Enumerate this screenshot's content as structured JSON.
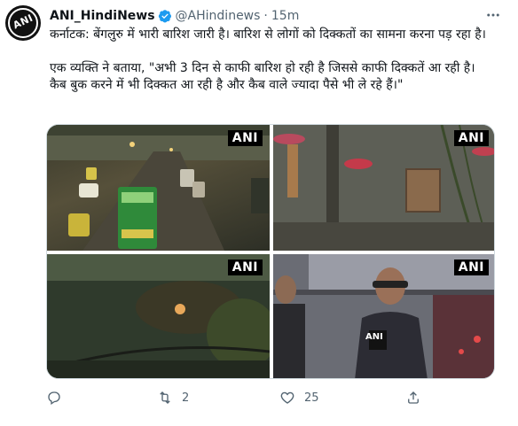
{
  "tweet": {
    "display_name": "ANI_HindiNews",
    "handle": "@AHindinews",
    "separator": "·",
    "time": "15m",
    "avatar_text": "ANI",
    "paragraph1": "कर्नाटक: बेंगलुरु में भारी बारिश जारी है। बारिश से लोगों को दिक्कतों का सामना करना पड़ रहा है।",
    "paragraph2": "एक व्यक्ति ने बताया, \"अभी 3 दिन से काफी बारिश हो रही है जिससे काफी दिक्कतें आ रही है। कैब बुक करने में भी दिक्कत आ रही है और कैब वाले ज्यादा पैसे भी ले रहे हैं।\""
  },
  "media": {
    "watermark": "ANI",
    "mic_label": "ANI"
  },
  "actions": {
    "reply_count": "",
    "retweet_count": "2",
    "like_count": "25"
  },
  "colors": {
    "verified": "#1d9bf0",
    "secondary_text": "#536471"
  },
  "icons": [
    "verified-badge-icon",
    "more-icon",
    "reply-icon",
    "retweet-icon",
    "like-icon",
    "share-icon"
  ]
}
